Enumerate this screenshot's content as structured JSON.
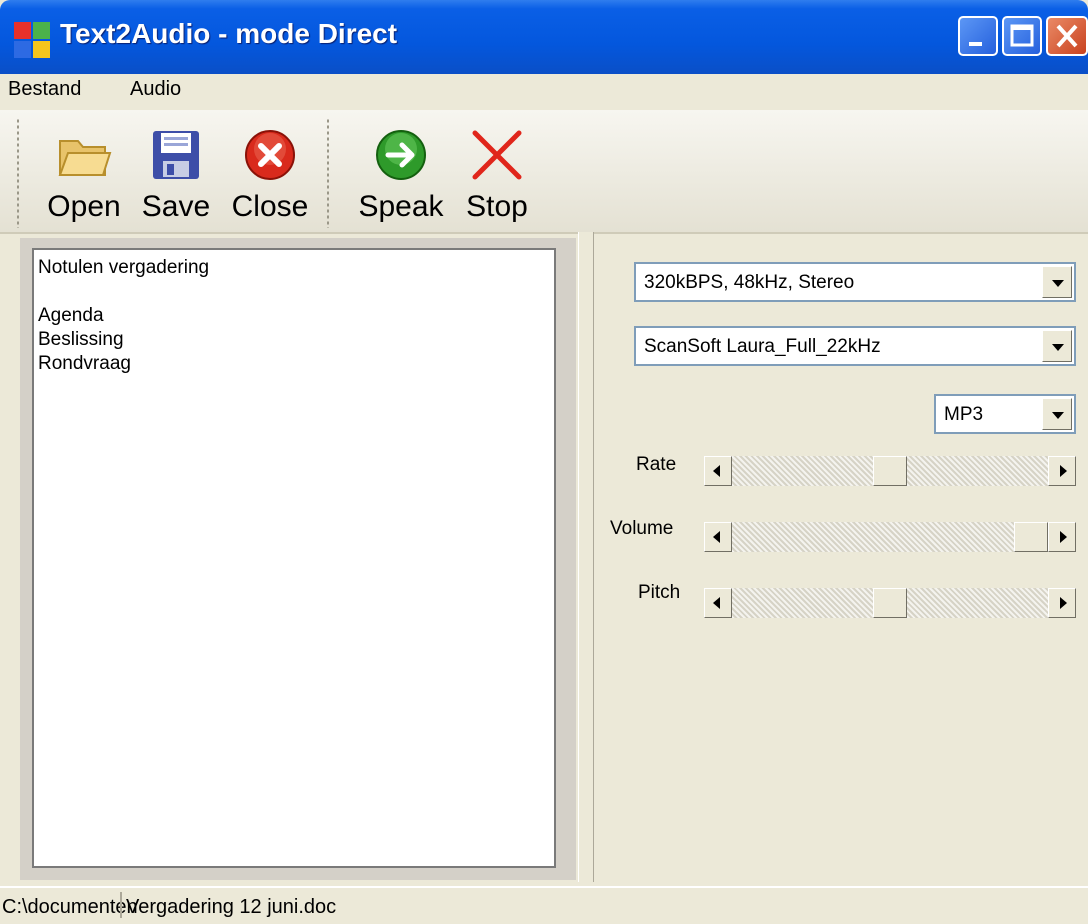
{
  "window": {
    "title": "Text2Audio - mode Direct",
    "buttons": [
      "minimize",
      "maximize",
      "close"
    ]
  },
  "menu": {
    "items": [
      "Bestand",
      "Audio"
    ]
  },
  "toolbar": {
    "buttons": [
      {
        "label": "Open",
        "icon": "folder-icon"
      },
      {
        "label": "Save",
        "icon": "floppy-disk-icon"
      },
      {
        "label": "Close",
        "icon": "close-circle-icon"
      },
      {
        "label": "Speak",
        "icon": "arrow-right-circle-icon"
      },
      {
        "label": "Stop",
        "icon": "stop-x-icon"
      }
    ]
  },
  "editor": {
    "lines": [
      "Notulen vergadering",
      "",
      "Agenda",
      "Beslissing",
      "Rondvraag"
    ]
  },
  "settings": {
    "quality": "320kBPS, 48kHz, Stereo",
    "voice": "ScanSoft Laura_Full_22kHz",
    "format": "MP3",
    "sliders": [
      {
        "label": "Rate",
        "value": 0.5
      },
      {
        "label": "Volume",
        "value": 1.0
      },
      {
        "label": "Pitch",
        "value": 0.5
      }
    ]
  },
  "status": {
    "path": "C:\\documenten",
    "file": "Vergadering 12 juni.doc"
  },
  "colors": {
    "titlebar": "#0457dd",
    "face": "#ece9d8"
  }
}
